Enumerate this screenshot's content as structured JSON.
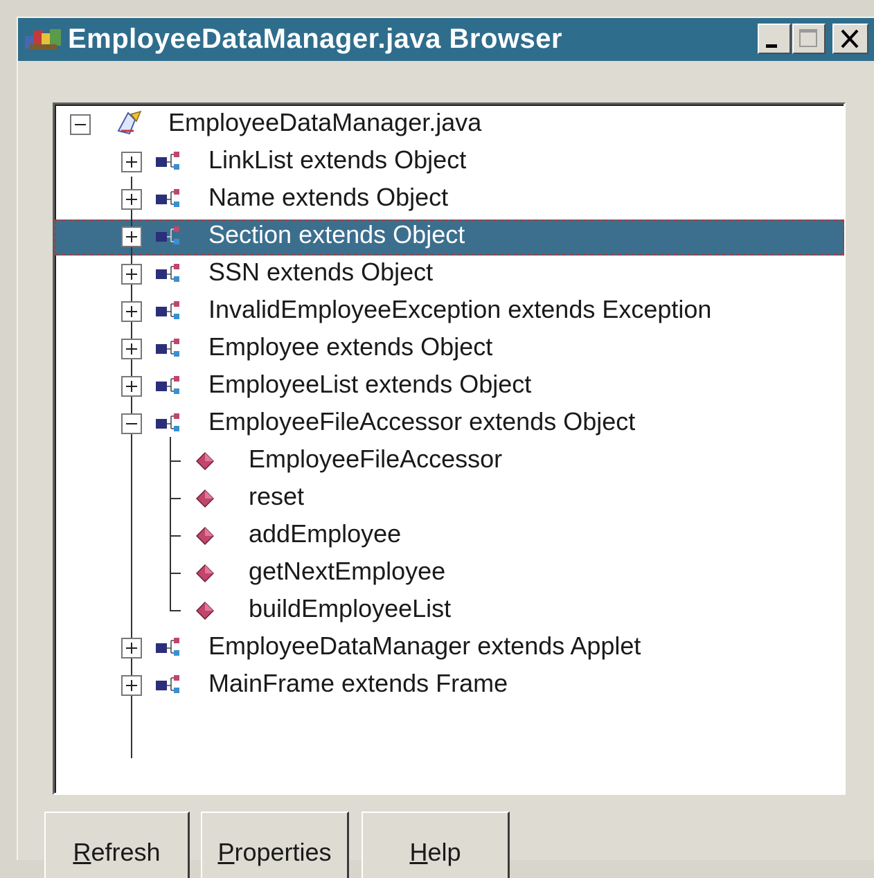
{
  "window": {
    "title": "EmployeeDataManager.java Browser"
  },
  "tree": {
    "root_label": "EmployeeDataManager.java",
    "classes": [
      {
        "label": "LinkList extends Object",
        "expanded": false,
        "selected": false
      },
      {
        "label": "Name extends Object",
        "expanded": false,
        "selected": false
      },
      {
        "label": "Section extends Object",
        "expanded": false,
        "selected": true
      },
      {
        "label": "SSN extends Object",
        "expanded": false,
        "selected": false
      },
      {
        "label": "InvalidEmployeeException extends Exception",
        "expanded": false,
        "selected": false
      },
      {
        "label": "Employee extends Object",
        "expanded": false,
        "selected": false
      },
      {
        "label": "EmployeeList extends Object",
        "expanded": false,
        "selected": false
      },
      {
        "label": "EmployeeFileAccessor extends Object",
        "expanded": true,
        "selected": false
      },
      {
        "label": "EmployeeDataManager extends Applet",
        "expanded": false,
        "selected": false
      },
      {
        "label": "MainFrame extends Frame",
        "expanded": false,
        "selected": false
      }
    ],
    "methods": [
      {
        "label": "EmployeeFileAccessor"
      },
      {
        "label": "reset"
      },
      {
        "label": "addEmployee"
      },
      {
        "label": "getNextEmployee"
      },
      {
        "label": "buildEmployeeList"
      }
    ]
  },
  "buttons": {
    "refresh": {
      "first": "R",
      "rest": "efresh"
    },
    "properties": {
      "first": "P",
      "rest": "roperties"
    },
    "help": {
      "first": "H",
      "rest": "elp"
    }
  },
  "colors": {
    "titlebar": "#2f6d8c",
    "selection": "#3c6f8e",
    "class_icon_dark": "#2b2f7a",
    "method_icon": "#c2456b"
  },
  "icons": {
    "app": "java-file-browser-icon",
    "root": "java-source-file-icon",
    "class": "class-icon",
    "method": "method-icon",
    "expand": "plus-box-icon",
    "collapse": "minus-box-icon"
  }
}
